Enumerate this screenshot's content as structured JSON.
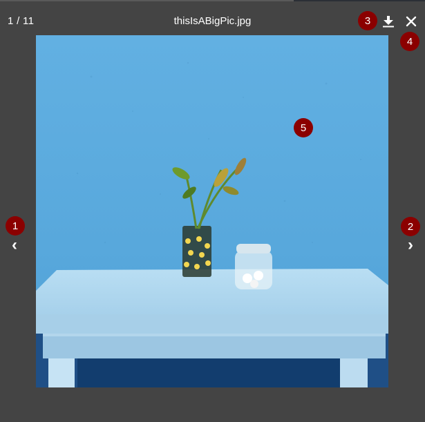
{
  "viewer": {
    "counter": "1 / 11",
    "filename": "thisIsABigPic.jpg"
  },
  "controls": {
    "prev_glyph": "‹",
    "next_glyph": "›",
    "download_icon": "download-icon",
    "close_icon": "close-icon"
  },
  "markers": [
    "1",
    "2",
    "3",
    "4",
    "5"
  ],
  "colors": {
    "backdrop": "#444444",
    "marker": "#8b0000",
    "wall": "#5aa7d9",
    "table": "#a9d4ee"
  }
}
